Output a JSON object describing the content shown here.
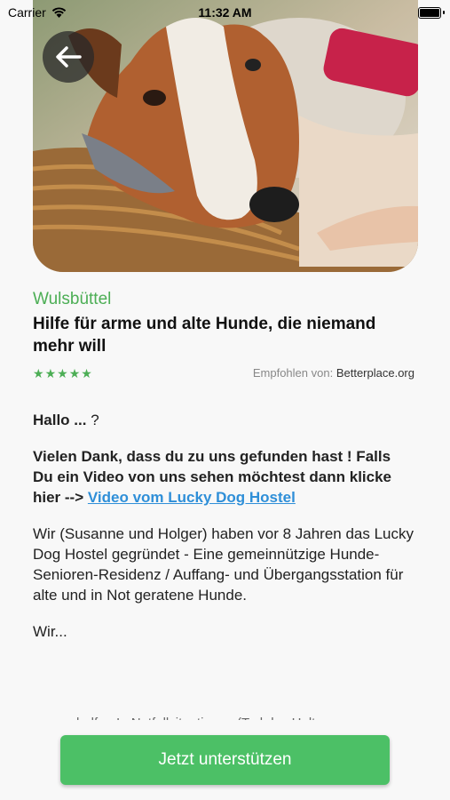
{
  "status_bar": {
    "carrier": "Carrier",
    "time": "11:32 AM"
  },
  "hero": {
    "image": "dog-in-basket-photo"
  },
  "nav": {
    "back_icon": "arrow-left-icon"
  },
  "project": {
    "location": "Wulsbüttel",
    "title": "Hilfe für arme und alte Hunde, die niemand mehr will",
    "rating": 5,
    "recommended_prefix": "Empfohlen von:",
    "recommended_source": "Betterplace.org"
  },
  "description": {
    "greeting_bold": "Hallo ...",
    "greeting_rest": " ?",
    "thanks": "Vielen Dank, dass du zu uns gefunden hast ! Falls Du ein Video von uns sehen möchtest dann klicke hier -->",
    "video_link": "Video vom Lucky Dog Hostel",
    "body": "Wir (Susanne und Holger) haben vor 8 Jahren das Lucky Dog Hostel gegründet - Eine gemeinnützige  Hunde-Senioren-Residenz / Auffang- und Übergangsstation für alte und in Not geratene Hunde.",
    "more": "Wir...",
    "faded": "helfen In Notfallsituationen (Tod des Halters"
  },
  "cta": {
    "label": "Jetzt unterstützen"
  },
  "colors": {
    "accent": "#4cae55",
    "cta": "#4cc066",
    "link": "#2f8fd8"
  }
}
